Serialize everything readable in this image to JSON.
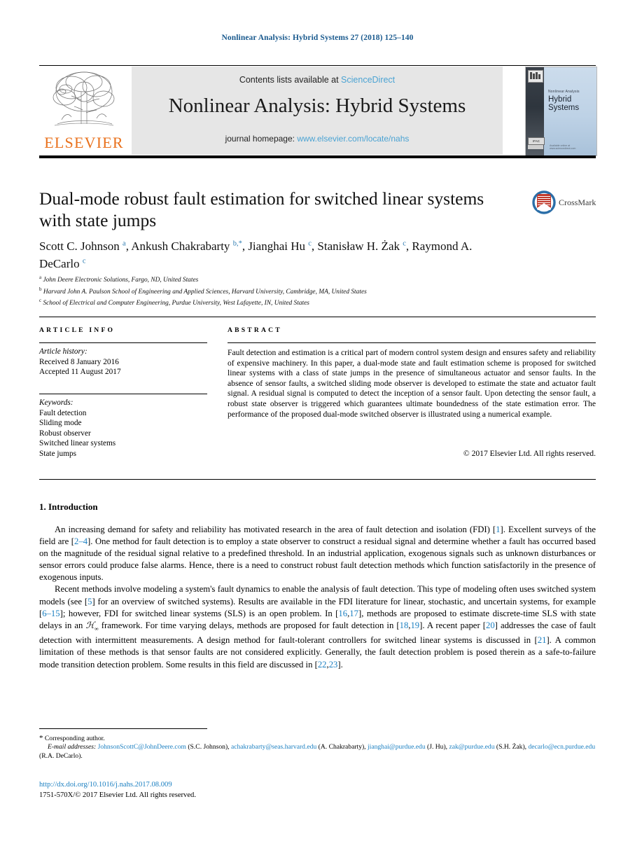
{
  "running_head": "Nonlinear Analysis: Hybrid Systems 27 (2018) 125–140",
  "masthead": {
    "contents_prefix": "Contents lists available at ",
    "contents_link": "ScienceDirect",
    "journal_title": "Nonlinear Analysis: Hybrid Systems",
    "homepage_prefix": "journal homepage: ",
    "homepage_link": "www.elsevier.com/locate/nahs",
    "publisher": "ELSEVIER",
    "cover": {
      "kicker": "Nonlinear Analysis",
      "title_line1": "Hybrid",
      "title_line2": "Systems",
      "badge": "IFAC",
      "footer": "Available online at www.sciencedirect.com"
    }
  },
  "article": {
    "title": "Dual-mode robust fault estimation for switched linear systems with state jumps",
    "authors_html": "Scott C. Johnson <sup>a</sup>, Ankush Chakrabarty <sup>b</sup><sup class=\"star\">,*</sup>, Jianghai Hu <sup>c</sup>, Stanisław H. Żak <sup>c</sup>, Raymond A. DeCarlo <sup>c</sup>",
    "affiliations": [
      {
        "mark": "a",
        "text": "John Deere Electronic Solutions, Fargo, ND, United States"
      },
      {
        "mark": "b",
        "text": "Harvard John A. Paulson School of Engineering and Applied Sciences, Harvard University, Cambridge, MA, United States"
      },
      {
        "mark": "c",
        "text": "School of Electrical and Computer Engineering, Purdue University, West Lafayette, IN, United States"
      }
    ],
    "crossmark_label": "CrossMark"
  },
  "info": {
    "header_article_info": "ARTICLE INFO",
    "header_abstract": "ABSTRACT",
    "history_label": "Article history:",
    "history": [
      "Received 8 January 2016",
      "Accepted 11 August 2017"
    ],
    "keywords_label": "Keywords:",
    "keywords": [
      "Fault detection",
      "Sliding mode",
      "Robust observer",
      "Switched linear systems",
      "State jumps"
    ],
    "abstract": "Fault detection and estimation is a critical part of modern control system design and ensures safety and reliability of expensive machinery. In this paper, a dual-mode state and fault estimation scheme is proposed for switched linear systems with a class of state jumps in the presence of simultaneous actuator and sensor faults. In the absence of sensor faults, a switched sliding mode observer is developed to estimate the state and actuator fault signal. A residual signal is computed to detect the inception of a sensor fault. Upon detecting the sensor fault, a robust state observer is triggered which guarantees ultimate boundedness of the state estimation error. The performance of the proposed dual-mode switched observer is illustrated using a numerical example.",
    "copyright": "© 2017 Elsevier Ltd. All rights reserved."
  },
  "body": {
    "section_heading": "1. Introduction",
    "paragraph_1_html": "An increasing demand for safety and reliability has motivated research in the area of fault detection and isolation (FDI) [<span class=\"cite\">1</span>]. Excellent surveys of the field are [<span class=\"cite\">2–4</span>]. One method for fault detection is to employ a state observer to construct a residual signal and determine whether a fault has occurred based on the magnitude of the residual signal relative to a predefined threshold. In an industrial application, exogenous signals such as unknown disturbances or sensor errors could produce false alarms. Hence, there is a need to construct robust fault detection methods which function satisfactorily in the presence of exogenous inputs.",
    "paragraph_2_html": "Recent methods involve modeling a system's fault dynamics to enable the analysis of fault detection. This type of modeling often uses switched system models (see [<span class=\"cite\">5</span>] for an overview of switched systems). Results are available in the FDI literature for linear, stochastic, and uncertain systems, for example [<span class=\"cite\">6–15</span>]; however, FDI for switched linear systems (SLS) is an open problem. In [<span class=\"cite\">16</span>,<span class=\"cite\">17</span>], methods are proposed to estimate discrete-time SLS with state delays in an <span class=\"hinf\">&#x210B;<sub>∞</sub></span> framework. For time varying delays, methods are proposed for fault detection in [<span class=\"cite\">18</span>,<span class=\"cite\">19</span>]. A recent paper [<span class=\"cite\">20</span>] addresses the case of fault detection with intermittent measurements. A design method for fault-tolerant controllers for switched linear systems is discussed in [<span class=\"cite\">21</span>]. A common limitation of these methods is that sensor faults are not considered explicitly. Generally, the fault detection problem is posed therein as a safe-to-failure mode transition detection problem. Some results in this field are discussed in [<span class=\"cite\">22</span>,<span class=\"cite\">23</span>]."
  },
  "footer": {
    "corresponding_author": "Corresponding author.",
    "email_label": "E-mail addresses:",
    "emails_html": "<a href=\"#\">JohnsonScottC@JohnDeere.com</a> (S.C. Johnson), <a href=\"#\">achakrabarty@seas.harvard.edu</a> (A. Chakrabarty), <a href=\"#\">jianghai@purdue.edu</a> (J. Hu), <a href=\"#\">zak@purdue.edu</a> (S.H. Żak), <a href=\"#\">decarlo@ecn.purdue.edu</a> (R.A. DeCarlo).",
    "doi": "http://dx.doi.org/10.1016/j.nahs.2017.08.009",
    "issn": "1751-570X/© 2017 Elsevier Ltd. All rights reserved."
  },
  "colors": {
    "link_blue": "#1a7fc1",
    "sciencedirect_blue": "#4ba3d3",
    "elsevier_orange": "#E9711C",
    "runhead_blue": "#1a5a8e"
  }
}
